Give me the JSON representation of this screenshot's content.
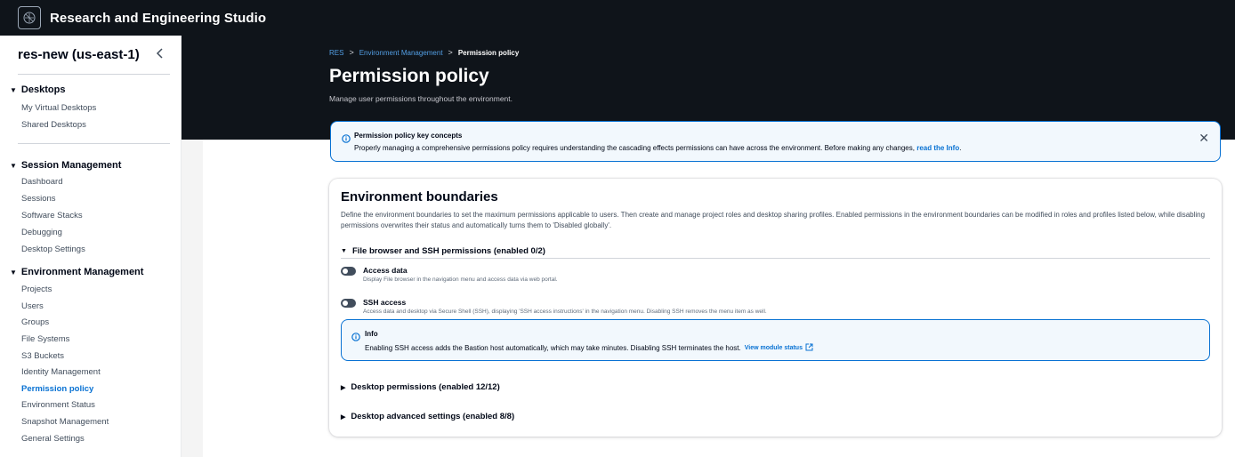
{
  "app": {
    "title": "Research and Engineering Studio"
  },
  "sidebar": {
    "title": "res-new (us-east-1)",
    "sections": [
      {
        "label": "Desktops",
        "items": [
          "My Virtual Desktops",
          "Shared Desktops"
        ]
      },
      {
        "label": "Session Management",
        "items": [
          "Dashboard",
          "Sessions",
          "Software Stacks",
          "Debugging",
          "Desktop Settings"
        ]
      },
      {
        "label": "Environment Management",
        "items": [
          "Projects",
          "Users",
          "Groups",
          "File Systems",
          "S3 Buckets",
          "Identity Management",
          "Permission policy",
          "Environment Status",
          "Snapshot Management",
          "General Settings"
        ]
      }
    ],
    "active_item": "Permission policy"
  },
  "breadcrumb": {
    "items": [
      "RES",
      "Environment Management"
    ],
    "current": "Permission policy"
  },
  "page": {
    "title": "Permission policy",
    "description": "Manage user permissions throughout the environment."
  },
  "flash": {
    "title": "Permission policy key concepts",
    "text": "Properly managing a comprehensive permissions policy requires understanding the cascading effects permissions can have across the environment. Before making any changes, ",
    "link": "read the Info",
    "suffix": "."
  },
  "card": {
    "title": "Environment boundaries",
    "description": "Define the environment boundaries to set the maximum permissions applicable to users. Then create and manage project roles and desktop sharing profiles. Enabled permissions in the environment boundaries can be modified in roles and profiles listed below, while disabling permissions overwrites their status and automatically turns them to 'Disabled globally'.",
    "sections": {
      "file_browser": "File browser and SSH permissions (enabled 0/2)",
      "desktop": "Desktop permissions (enabled 12/12)",
      "desktop_advanced": "Desktop advanced settings (enabled 8/8)"
    },
    "toggles": [
      {
        "label": "Access data",
        "description": "Display File browser in the navigation menu and access data via web portal.",
        "enabled": false
      },
      {
        "label": "SSH access",
        "description": "Access data and desktop via Secure Shell (SSH), displaying 'SSH access instructions' in the navigation menu. Disabling SSH removes the menu item as well.",
        "enabled": false
      }
    ],
    "info": {
      "title": "Info",
      "text": "Enabling SSH access adds the Bastion host automatically, which may take minutes. Disabling SSH terminates the host.",
      "link": "View module status"
    }
  },
  "colors": {
    "header_bg": "#0f141a",
    "accent": "#0972d3",
    "info_bg": "#f2f8fd"
  },
  "icons": {
    "logo": "res-logo-icon",
    "collapse": "chevron-left-icon",
    "info": "info-icon",
    "close": "close-icon",
    "external": "external-link-icon"
  }
}
